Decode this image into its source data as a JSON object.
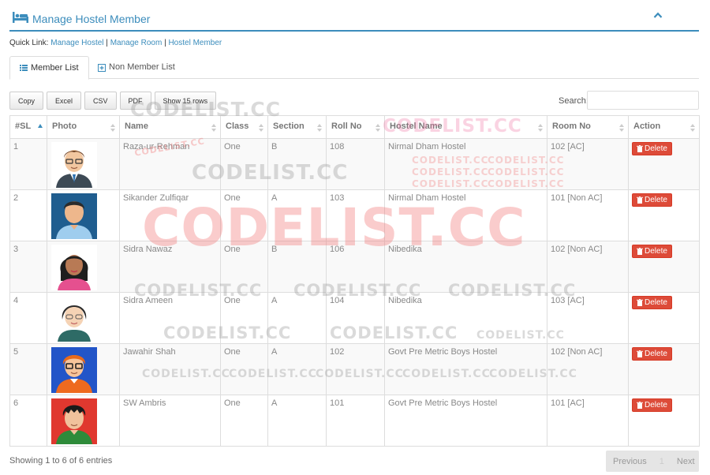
{
  "panel": {
    "title": "Manage Hostel Member"
  },
  "quicklink": {
    "label": "Quick Link:",
    "links": [
      "Manage Hostel",
      "Manage Room",
      "Hostel Member"
    ],
    "sep": "|"
  },
  "tabs": {
    "member_list": "Member List",
    "non_member_list": "Non Member List"
  },
  "buttons": {
    "copy": "Copy",
    "excel": "Excel",
    "csv": "CSV",
    "pdf": "PDF",
    "show_rows": "Show 15 rows"
  },
  "search": {
    "label": "Search:",
    "value": ""
  },
  "table": {
    "headers": [
      "#SL",
      "Photo",
      "Name",
      "Class",
      "Section",
      "Roll No",
      "Hostel Name",
      "Room No",
      "Action"
    ],
    "rows": [
      {
        "sl": "1",
        "name": "Raza-ur-Rehman",
        "class": "One",
        "section": "B",
        "roll": "108",
        "hostel": "Nirmal Dham Hostel",
        "room": "102 [AC]",
        "action": "Delete"
      },
      {
        "sl": "2",
        "name": "Sikander Zulfiqar",
        "class": "One",
        "section": "A",
        "roll": "103",
        "hostel": "Nirmal Dham Hostel",
        "room": "101 [Non AC]",
        "action": "Delete"
      },
      {
        "sl": "3",
        "name": "Sidra Nawaz",
        "class": "One",
        "section": "B",
        "roll": "106",
        "hostel": "Nibedika",
        "room": "102 [Non AC]",
        "action": "Delete"
      },
      {
        "sl": "4",
        "name": "Sidra Ameen",
        "class": "One",
        "section": "A",
        "roll": "104",
        "hostel": "Nibedika",
        "room": "103 [AC]",
        "action": "Delete"
      },
      {
        "sl": "5",
        "name": "Jawahir Shah",
        "class": "One",
        "section": "A",
        "roll": "102",
        "hostel": "Govt Pre Metric Boys Hostel",
        "room": "102 [Non AC]",
        "action": "Delete"
      },
      {
        "sl": "6",
        "name": "SW Ambris",
        "class": "One",
        "section": "A",
        "roll": "101",
        "hostel": "Govt Pre Metric Boys Hostel",
        "room": "101 [AC]",
        "action": "Delete"
      }
    ]
  },
  "footer": {
    "info": "Showing 1 to 6 of 6 entries",
    "previous": "Previous",
    "page": "1",
    "next": "Next"
  },
  "watermark": {
    "text": "CODELIST.CC",
    "red": "#f08080",
    "gray": "#9a9a9a"
  },
  "colors": {
    "accent": "#3c8dbc",
    "danger": "#dd4b39"
  },
  "icons": {
    "panel": "bed-icon",
    "collapse": "chevron-up-icon",
    "member_tab": "list-icon",
    "non_member_tab": "plus-square-icon",
    "delete": "trash-icon"
  }
}
